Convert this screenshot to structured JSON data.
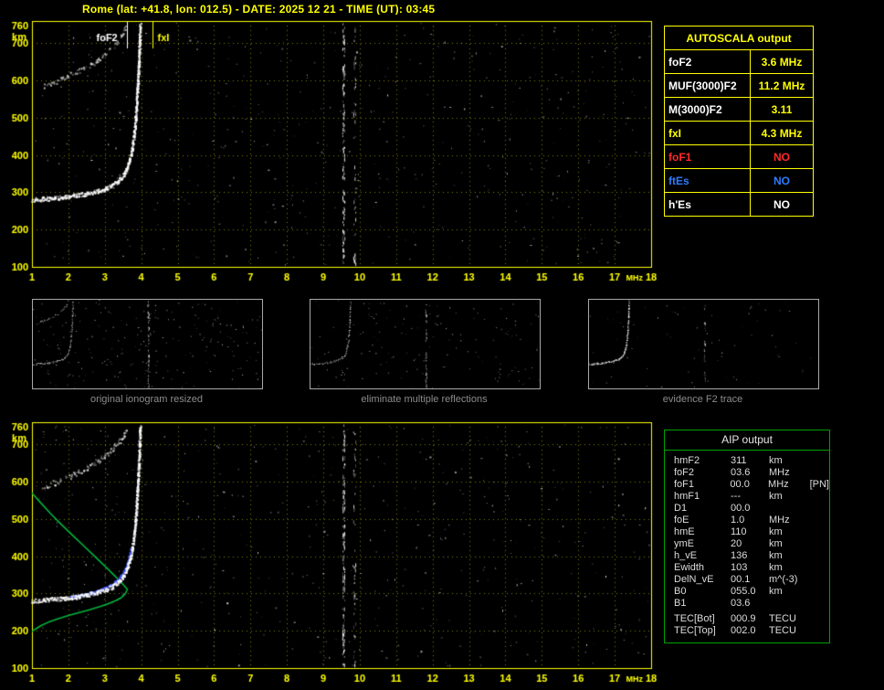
{
  "header": {
    "title": "Rome (lat: +41.8, lon: 012.5) - DATE: 2025 12 21 - TIME (UT): 03:45"
  },
  "autoscala": {
    "title": "AUTOSCALA output",
    "rows": [
      {
        "label": "foF2",
        "value": "3.6 MHz",
        "label_color": "#FFFFFF",
        "value_color": "#FFFF00"
      },
      {
        "label": "MUF(3000)F2",
        "value": "11.2 MHz",
        "label_color": "#FFFFFF",
        "value_color": "#FFFF00"
      },
      {
        "label": "M(3000)F2",
        "value": "3.11",
        "label_color": "#FFFFFF",
        "value_color": "#FFFF00"
      },
      {
        "label": "fxI",
        "value": "4.3 MHz",
        "label_color": "#FFFF00",
        "value_color": "#FFFF00"
      },
      {
        "label": "foF1",
        "value": "NO",
        "label_color": "#FF2A2A",
        "value_color": "#FF2A2A"
      },
      {
        "label": "ftEs",
        "value": "NO",
        "label_color": "#2E7CFF",
        "value_color": "#2E7CFF"
      },
      {
        "label": "h'Es",
        "value": "NO",
        "label_color": "#FFFFFF",
        "value_color": "#FFFFFF"
      }
    ]
  },
  "aip": {
    "title": "AIP output",
    "rows": [
      {
        "label": "hmF2",
        "value": "311",
        "unit": "km",
        "extra": ""
      },
      {
        "label": "foF2",
        "value": "03.6",
        "unit": "MHz",
        "extra": ""
      },
      {
        "label": "foF1",
        "value": "00.0",
        "unit": "MHz",
        "extra": "[PN]"
      },
      {
        "label": "hmF1",
        "value": "---",
        "unit": "km",
        "extra": ""
      },
      {
        "label": "D1",
        "value": "00.0",
        "unit": "",
        "extra": ""
      },
      {
        "label": "foE",
        "value": "1.0",
        "unit": "MHz",
        "extra": ""
      },
      {
        "label": "hmE",
        "value": "110",
        "unit": "km",
        "extra": ""
      },
      {
        "label": "ymE",
        "value": "20",
        "unit": "km",
        "extra": ""
      },
      {
        "label": "h_vE",
        "value": "136",
        "unit": "km",
        "extra": ""
      },
      {
        "label": "Ewidth",
        "value": "103",
        "unit": "km",
        "extra": ""
      },
      {
        "label": "DelN_vE",
        "value": "00.1",
        "unit": "m^(-3)",
        "extra": ""
      },
      {
        "label": "B0",
        "value": "055.0",
        "unit": "km",
        "extra": ""
      },
      {
        "label": "B1",
        "value": "03.6",
        "unit": "",
        "extra": ""
      },
      {
        "label": "TEC[Bot]",
        "value": "000.9",
        "unit": "TECU",
        "extra": "",
        "gap_before": true
      },
      {
        "label": "TEC[Top]",
        "value": "002.0",
        "unit": "TECU",
        "extra": ""
      }
    ]
  },
  "thumbnails": [
    {
      "caption": "original ionogram resized"
    },
    {
      "caption": "eliminate multiple reflections"
    },
    {
      "caption": "evidence F2 trace"
    }
  ],
  "chart_data": {
    "type": "scatter",
    "title": "Rome ionogram 2025 12 21 03:45 UT (top: raw autoscaled, bottom: fitted with electron density profile)",
    "xlabel": "MHz",
    "ylabel": "km",
    "xlim": [
      1,
      18
    ],
    "ylim": [
      100,
      760
    ],
    "x_ticks": [
      1,
      2,
      3,
      4,
      5,
      6,
      7,
      8,
      9,
      10,
      11,
      12,
      13,
      14,
      15,
      16,
      17,
      18
    ],
    "y_ticks": [
      760,
      700,
      600,
      500,
      400,
      300,
      200,
      100
    ],
    "grid": true,
    "markers": [
      {
        "label": "foF2",
        "freq": 3.6,
        "color": "#FFFFFF",
        "text_dx": -34
      },
      {
        "label": "fxI",
        "freq": 4.3,
        "color": "#FFFF00",
        "text_dx": 5
      }
    ],
    "interference_freqs": [
      9.55,
      9.85
    ],
    "series": {
      "f2_trace": [
        [
          1.0,
          282
        ],
        [
          1.3,
          284
        ],
        [
          1.6,
          286
        ],
        [
          1.9,
          289
        ],
        [
          2.2,
          293
        ],
        [
          2.5,
          298
        ],
        [
          2.8,
          305
        ],
        [
          3.0,
          311
        ],
        [
          3.2,
          320
        ],
        [
          3.35,
          331
        ],
        [
          3.5,
          348
        ],
        [
          3.6,
          368
        ],
        [
          3.68,
          392
        ],
        [
          3.74,
          420
        ],
        [
          3.79,
          455
        ],
        [
          3.83,
          495
        ],
        [
          3.86,
          540
        ],
        [
          3.89,
          590
        ],
        [
          3.92,
          645
        ],
        [
          3.94,
          700
        ],
        [
          3.96,
          750
        ]
      ],
      "second_hop": [
        [
          1.3,
          588
        ],
        [
          1.6,
          598
        ],
        [
          1.9,
          610
        ],
        [
          2.2,
          624
        ],
        [
          2.5,
          640
        ],
        [
          2.8,
          658
        ],
        [
          3.0,
          672
        ],
        [
          3.2,
          690
        ],
        [
          3.35,
          708
        ],
        [
          3.5,
          728
        ],
        [
          3.6,
          748
        ]
      ],
      "fitted_f2": [
        [
          2.05,
          291
        ],
        [
          2.25,
          295
        ],
        [
          2.45,
          299
        ],
        [
          2.65,
          304
        ],
        [
          2.85,
          310
        ],
        [
          3.0,
          316
        ],
        [
          3.15,
          324
        ],
        [
          3.3,
          334
        ],
        [
          3.42,
          347
        ],
        [
          3.52,
          362
        ],
        [
          3.6,
          380
        ],
        [
          3.66,
          400
        ],
        [
          3.7,
          420
        ]
      ],
      "profile_topside": [
        [
          1.0,
          570
        ],
        [
          1.2,
          548
        ],
        [
          1.5,
          516
        ],
        [
          1.8,
          486
        ],
        [
          2.1,
          458
        ],
        [
          2.4,
          430
        ],
        [
          2.7,
          402
        ],
        [
          3.0,
          374
        ],
        [
          3.25,
          350
        ],
        [
          3.45,
          330
        ],
        [
          3.58,
          316
        ],
        [
          3.62,
          311
        ]
      ],
      "profile_bottomside": [
        [
          3.62,
          311
        ],
        [
          3.55,
          298
        ],
        [
          3.45,
          289
        ],
        [
          3.3,
          281
        ],
        [
          3.1,
          273
        ],
        [
          2.9,
          266
        ],
        [
          2.6,
          257
        ],
        [
          2.3,
          249
        ],
        [
          2.0,
          241
        ],
        [
          1.7,
          232
        ],
        [
          1.45,
          223
        ],
        [
          1.25,
          214
        ],
        [
          1.1,
          205
        ],
        [
          1.0,
          198
        ]
      ]
    },
    "colors": {
      "axis": "#FFFF00",
      "grid": "#FFFF00",
      "trace": "255,255,255",
      "fitted": "70,90,255",
      "profile": "#00B43C"
    }
  }
}
